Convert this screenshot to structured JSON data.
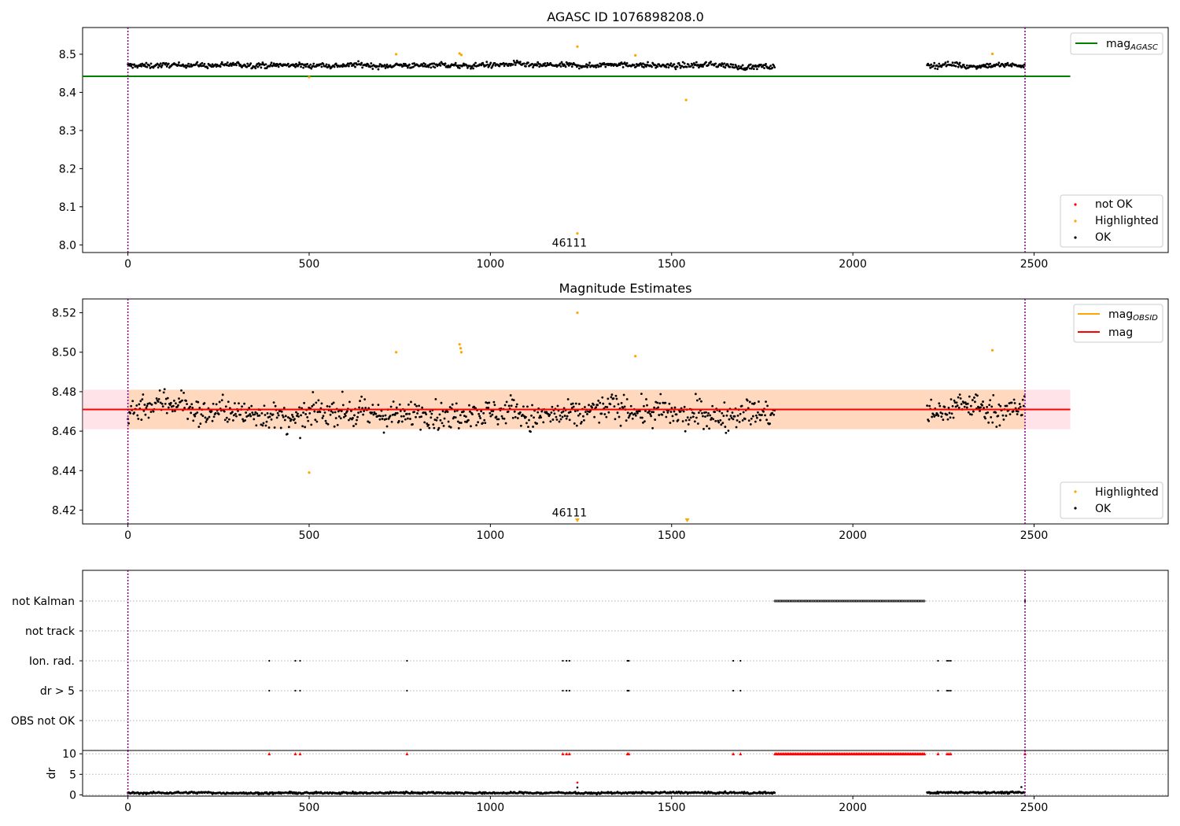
{
  "colors": {
    "ok": "#000000",
    "highlighted": "#ffa500",
    "not_ok": "#ff0000",
    "mag_agasc": "#008000",
    "mag_obsid": "#ffa500",
    "mag": "#ff0000",
    "obs_boundary": "#800080",
    "band_fill": "#ffc0cb"
  },
  "chart_data": [
    {
      "type": "scatter",
      "title": "AGASC ID 1076898208.0",
      "xlim": [
        -125,
        2870
      ],
      "ylim": [
        7.98,
        8.57
      ],
      "xticks": [
        0,
        500,
        1000,
        1500,
        2000,
        2500
      ],
      "yticks": [
        8.0,
        8.1,
        8.2,
        8.3,
        8.4,
        8.5
      ],
      "xtick_labels": [
        "0",
        "500",
        "1000",
        "1500",
        "2000",
        "2500"
      ],
      "ytick_labels": [
        "8.0",
        "8.1",
        "8.2",
        "8.3",
        "8.4",
        "8.5"
      ],
      "obs_boundaries": [
        0,
        2475
      ],
      "obsid_annotation": {
        "x": 1240,
        "y": 8.0,
        "text": "46111"
      },
      "mag_agasc": {
        "value": 8.442,
        "x_range": [
          -125,
          2600
        ]
      },
      "ok_segments": [
        [
          0,
          1785
        ],
        [
          2205,
          2475
        ]
      ],
      "ok_level": 8.47,
      "ok_spread": 0.011,
      "highlighted_points": [
        [
          500,
          8.44
        ],
        [
          740,
          8.5
        ],
        [
          915,
          8.502
        ],
        [
          920,
          8.498
        ],
        [
          1240,
          8.52
        ],
        [
          1240,
          8.03
        ],
        [
          1400,
          8.497
        ],
        [
          1540,
          8.38
        ],
        [
          2385,
          8.501
        ]
      ],
      "not_ok_points": [],
      "legend_lines": [
        {
          "label": "mag",
          "sub": "AGASC",
          "color_key": "mag_agasc"
        }
      ],
      "legend_markers": [
        {
          "label": "not OK",
          "color_key": "not_ok"
        },
        {
          "label": "Highlighted",
          "color_key": "highlighted"
        },
        {
          "label": "OK",
          "color_key": "ok"
        }
      ]
    },
    {
      "type": "scatter",
      "title": "Magnitude Estimates",
      "xlim": [
        -125,
        2870
      ],
      "ylim": [
        8.413,
        8.527
      ],
      "xticks": [
        0,
        500,
        1000,
        1500,
        2000,
        2500
      ],
      "yticks": [
        8.42,
        8.44,
        8.46,
        8.48,
        8.5,
        8.52
      ],
      "xtick_labels": [
        "0",
        "500",
        "1000",
        "1500",
        "2000",
        "2500"
      ],
      "ytick_labels": [
        "8.42",
        "8.44",
        "8.46",
        "8.48",
        "8.50",
        "8.52"
      ],
      "obs_boundaries": [
        0,
        2475
      ],
      "obsid_annotation": {
        "x": 1240,
        "y": 8.418,
        "text": "46111"
      },
      "mag": {
        "value": 8.471,
        "band": [
          8.461,
          8.481
        ],
        "x_range": [
          -125,
          2600
        ]
      },
      "mag_obsid": {
        "value": 8.471,
        "band": [
          8.461,
          8.481
        ],
        "x_range": [
          0,
          2475
        ]
      },
      "ok_segments": [
        [
          0,
          1785
        ],
        [
          2205,
          2475
        ]
      ],
      "ok_level": 8.47,
      "ok_spread": 0.011,
      "highlighted_points": [
        [
          500,
          8.439
        ],
        [
          740,
          8.5
        ],
        [
          915,
          8.504
        ],
        [
          918,
          8.502
        ],
        [
          920,
          8.5
        ],
        [
          1240,
          8.52
        ],
        [
          1400,
          8.498
        ],
        [
          2385,
          8.501
        ]
      ],
      "offscale_low_points": [
        1240,
        1543
      ],
      "legend_lines": [
        {
          "label": "mag",
          "sub": "OBSID",
          "color_key": "mag_obsid"
        },
        {
          "label": "mag",
          "sub": "",
          "color_key": "mag"
        }
      ],
      "legend_markers": [
        {
          "label": "Highlighted",
          "color_key": "highlighted"
        },
        {
          "label": "OK",
          "color_key": "ok"
        }
      ]
    },
    {
      "type": "scatter",
      "title": "",
      "xlim": [
        -125,
        2870
      ],
      "categories": [
        "not Kalman",
        "not track",
        "Ion. rad.",
        "dr > 5",
        "OBS not OK"
      ],
      "obs_boundaries": [
        0,
        2475
      ],
      "flags": {
        "not Kalman": {
          "ranges": [
            [
              1785,
              2200
            ]
          ],
          "points": [
            2475
          ]
        },
        "not track": {
          "ranges": [],
          "points": []
        },
        "Ion. rad.": {
          "ranges": [],
          "points": [
            390,
            462,
            475,
            770,
            1200,
            1210,
            1218,
            1378,
            1382,
            1670,
            1690,
            2235,
            2260,
            2265,
            2270
          ]
        },
        "dr > 5": {
          "ranges": [],
          "points": [
            390,
            462,
            475,
            770,
            1200,
            1210,
            1218,
            1378,
            1382,
            1670,
            1690,
            2235,
            2260,
            2265,
            2270
          ]
        },
        "OBS not OK": {
          "ranges": [],
          "points": []
        }
      }
    },
    {
      "type": "scatter",
      "title": "",
      "ylabel": "dr",
      "xlim": [
        -125,
        2870
      ],
      "ylim": [
        -0.3,
        10.8
      ],
      "xticks": [
        0,
        500,
        1000,
        1500,
        2000,
        2500
      ],
      "yticks": [
        0,
        5,
        10
      ],
      "xtick_labels": [
        "0",
        "500",
        "1000",
        "1500",
        "2000",
        "2500"
      ],
      "ytick_labels": [
        "0",
        "5",
        "10"
      ],
      "obs_boundaries": [
        0,
        2475
      ],
      "clipped_value": 10,
      "clipped_points": [
        390,
        462,
        475,
        770,
        1200,
        1210,
        1218,
        1378,
        1382,
        1670,
        1690,
        2235,
        2260,
        2265,
        2270,
        2475
      ],
      "clipped_ranges": [
        [
          1785,
          2200
        ]
      ],
      "ok_segments": [
        [
          0,
          1785
        ],
        [
          2205,
          2475
        ]
      ],
      "ok_level": 0.5,
      "ok_spread": 0.35,
      "extra_points": [
        [
          1240,
          3.0,
          "not_ok"
        ],
        [
          1240,
          1.8,
          "ok"
        ],
        [
          2465,
          1.9,
          "ok"
        ]
      ]
    }
  ]
}
